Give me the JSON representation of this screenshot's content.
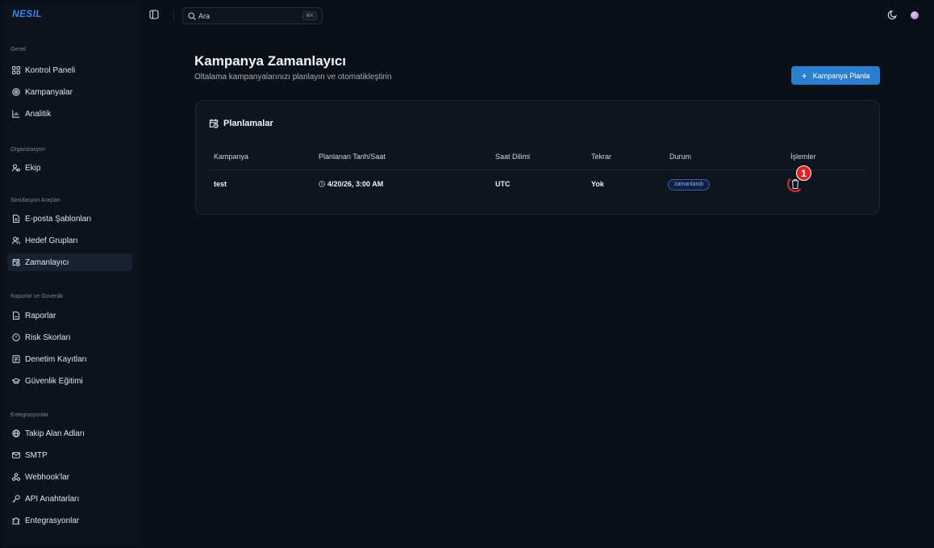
{
  "app": {
    "brand": "NESIL"
  },
  "topbar": {
    "search_placeholder": "Ara",
    "search_shortcut": "⌘K",
    "icons": [
      "panel-toggle-icon",
      "search-icon",
      "theme-toggle-icon",
      "avatar"
    ]
  },
  "sidebar": {
    "sections": [
      {
        "title": "Genel",
        "items": [
          {
            "label": "Kontrol Paneli",
            "icon": "dashboard-icon"
          },
          {
            "label": "Kampanyalar",
            "icon": "target-icon"
          },
          {
            "label": "Analitik",
            "icon": "chart-icon"
          }
        ]
      },
      {
        "title": "Organizasyon",
        "items": [
          {
            "label": "Ekip",
            "icon": "team-icon"
          }
        ]
      },
      {
        "title": "Simülasyon Araçları",
        "items": [
          {
            "label": "E-posta Şablonları",
            "icon": "template-icon"
          },
          {
            "label": "Hedef Grupları",
            "icon": "users-icon"
          },
          {
            "label": "Zamanlayıcı",
            "icon": "calendar-clock-icon",
            "active": true
          }
        ]
      },
      {
        "title": "Raporlar ve Güvenlik",
        "items": [
          {
            "label": "Raporlar",
            "icon": "file-icon"
          },
          {
            "label": "Risk Skorları",
            "icon": "shield-icon"
          },
          {
            "label": "Denetim Kayıtları",
            "icon": "scroll-icon"
          },
          {
            "label": "Güvenlik Eğitimi",
            "icon": "graduation-cap-icon"
          }
        ]
      },
      {
        "title": "Entegrasyonlar",
        "items": [
          {
            "label": "Takip Alan Adları",
            "icon": "globe-icon"
          },
          {
            "label": "SMTP",
            "icon": "mail-icon"
          },
          {
            "label": "Webhook'lar",
            "icon": "webhook-icon"
          },
          {
            "label": "API Anahtarları",
            "icon": "key-icon"
          },
          {
            "label": "Entegrasyonlar",
            "icon": "puzzle-icon"
          }
        ]
      }
    ]
  },
  "main": {
    "title": "Kampanya Zamanlayıcı",
    "subtitle": "Oltalama kampanyalarınızı planlayın ve otomatikleştirin",
    "primary_button": "Kampanya Planla",
    "card": {
      "title": "Planlamalar",
      "columns": [
        "Kampanya",
        "Planlanan Tarih/Saat",
        "Saat Dilimi",
        "Tekrar",
        "Durum",
        "İşlemler"
      ],
      "rows": [
        {
          "campaign": "test",
          "scheduled": "4/20/26, 3:00 AM",
          "timezone": "UTC",
          "repeat": "Yok",
          "status": "zamanlandı"
        }
      ]
    }
  },
  "annotation": {
    "number": "1",
    "color": "#e02424"
  },
  "colors": {
    "accent": "#2a7fd0",
    "background": "#0b0f17",
    "badge_border": "#2f5fb8"
  }
}
